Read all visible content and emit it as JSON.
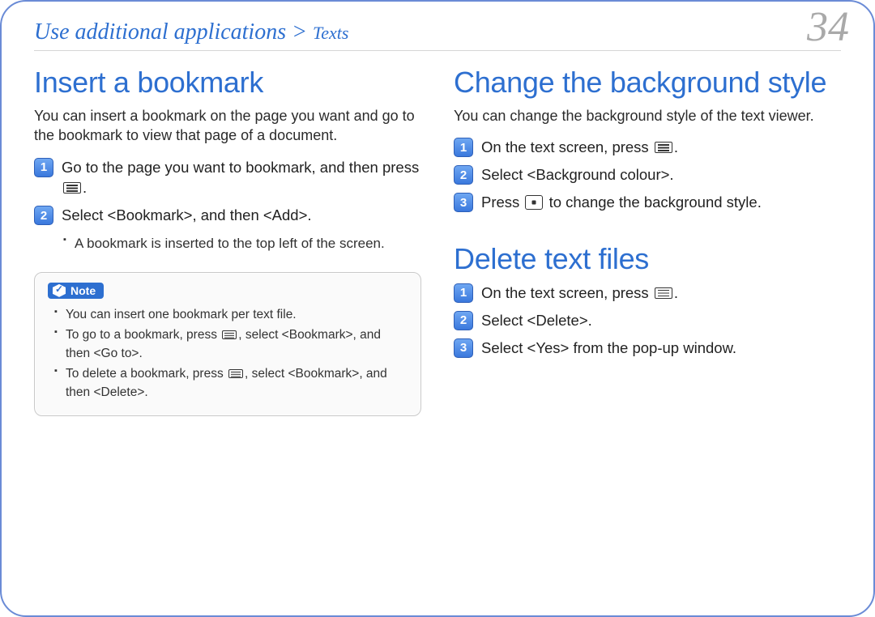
{
  "breadcrumb": {
    "parent": "Use additional applications",
    "sep": " > ",
    "child": "Texts"
  },
  "page_number": "34",
  "left": {
    "h": "Insert a bookmark",
    "lead": "You can insert a bookmark on the page you want and go to the bookmark to view that page of a document.",
    "s1a": "Go to the page you want to bookmark, and then press ",
    "s1b": ".",
    "s2": "Select <Bookmark>, and then <Add>.",
    "sb1": "A bookmark is inserted to the top left of the screen.",
    "note_label": "Note",
    "n1": "You can insert one bookmark per text file.",
    "n2a": "To go to a bookmark, press ",
    "n2b": ", select <Bookmark>, and then <Go to>.",
    "n3a": "To delete a bookmark, press ",
    "n3b": ", select <Bookmark>, and then <Delete>."
  },
  "right1": {
    "h": "Change the background style",
    "lead": "You can change the background style of the text viewer.",
    "s1a": "On the text screen, press ",
    "s1b": ".",
    "s2": "Select <Background colour>.",
    "s3a": "Press ",
    "s3b": " to change the background style."
  },
  "right2": {
    "h": "Delete text files",
    "s1a": "On the text screen, press ",
    "s1b": ".",
    "s2": "Select <Delete>.",
    "s3": "Select <Yes> from the pop-up window."
  }
}
